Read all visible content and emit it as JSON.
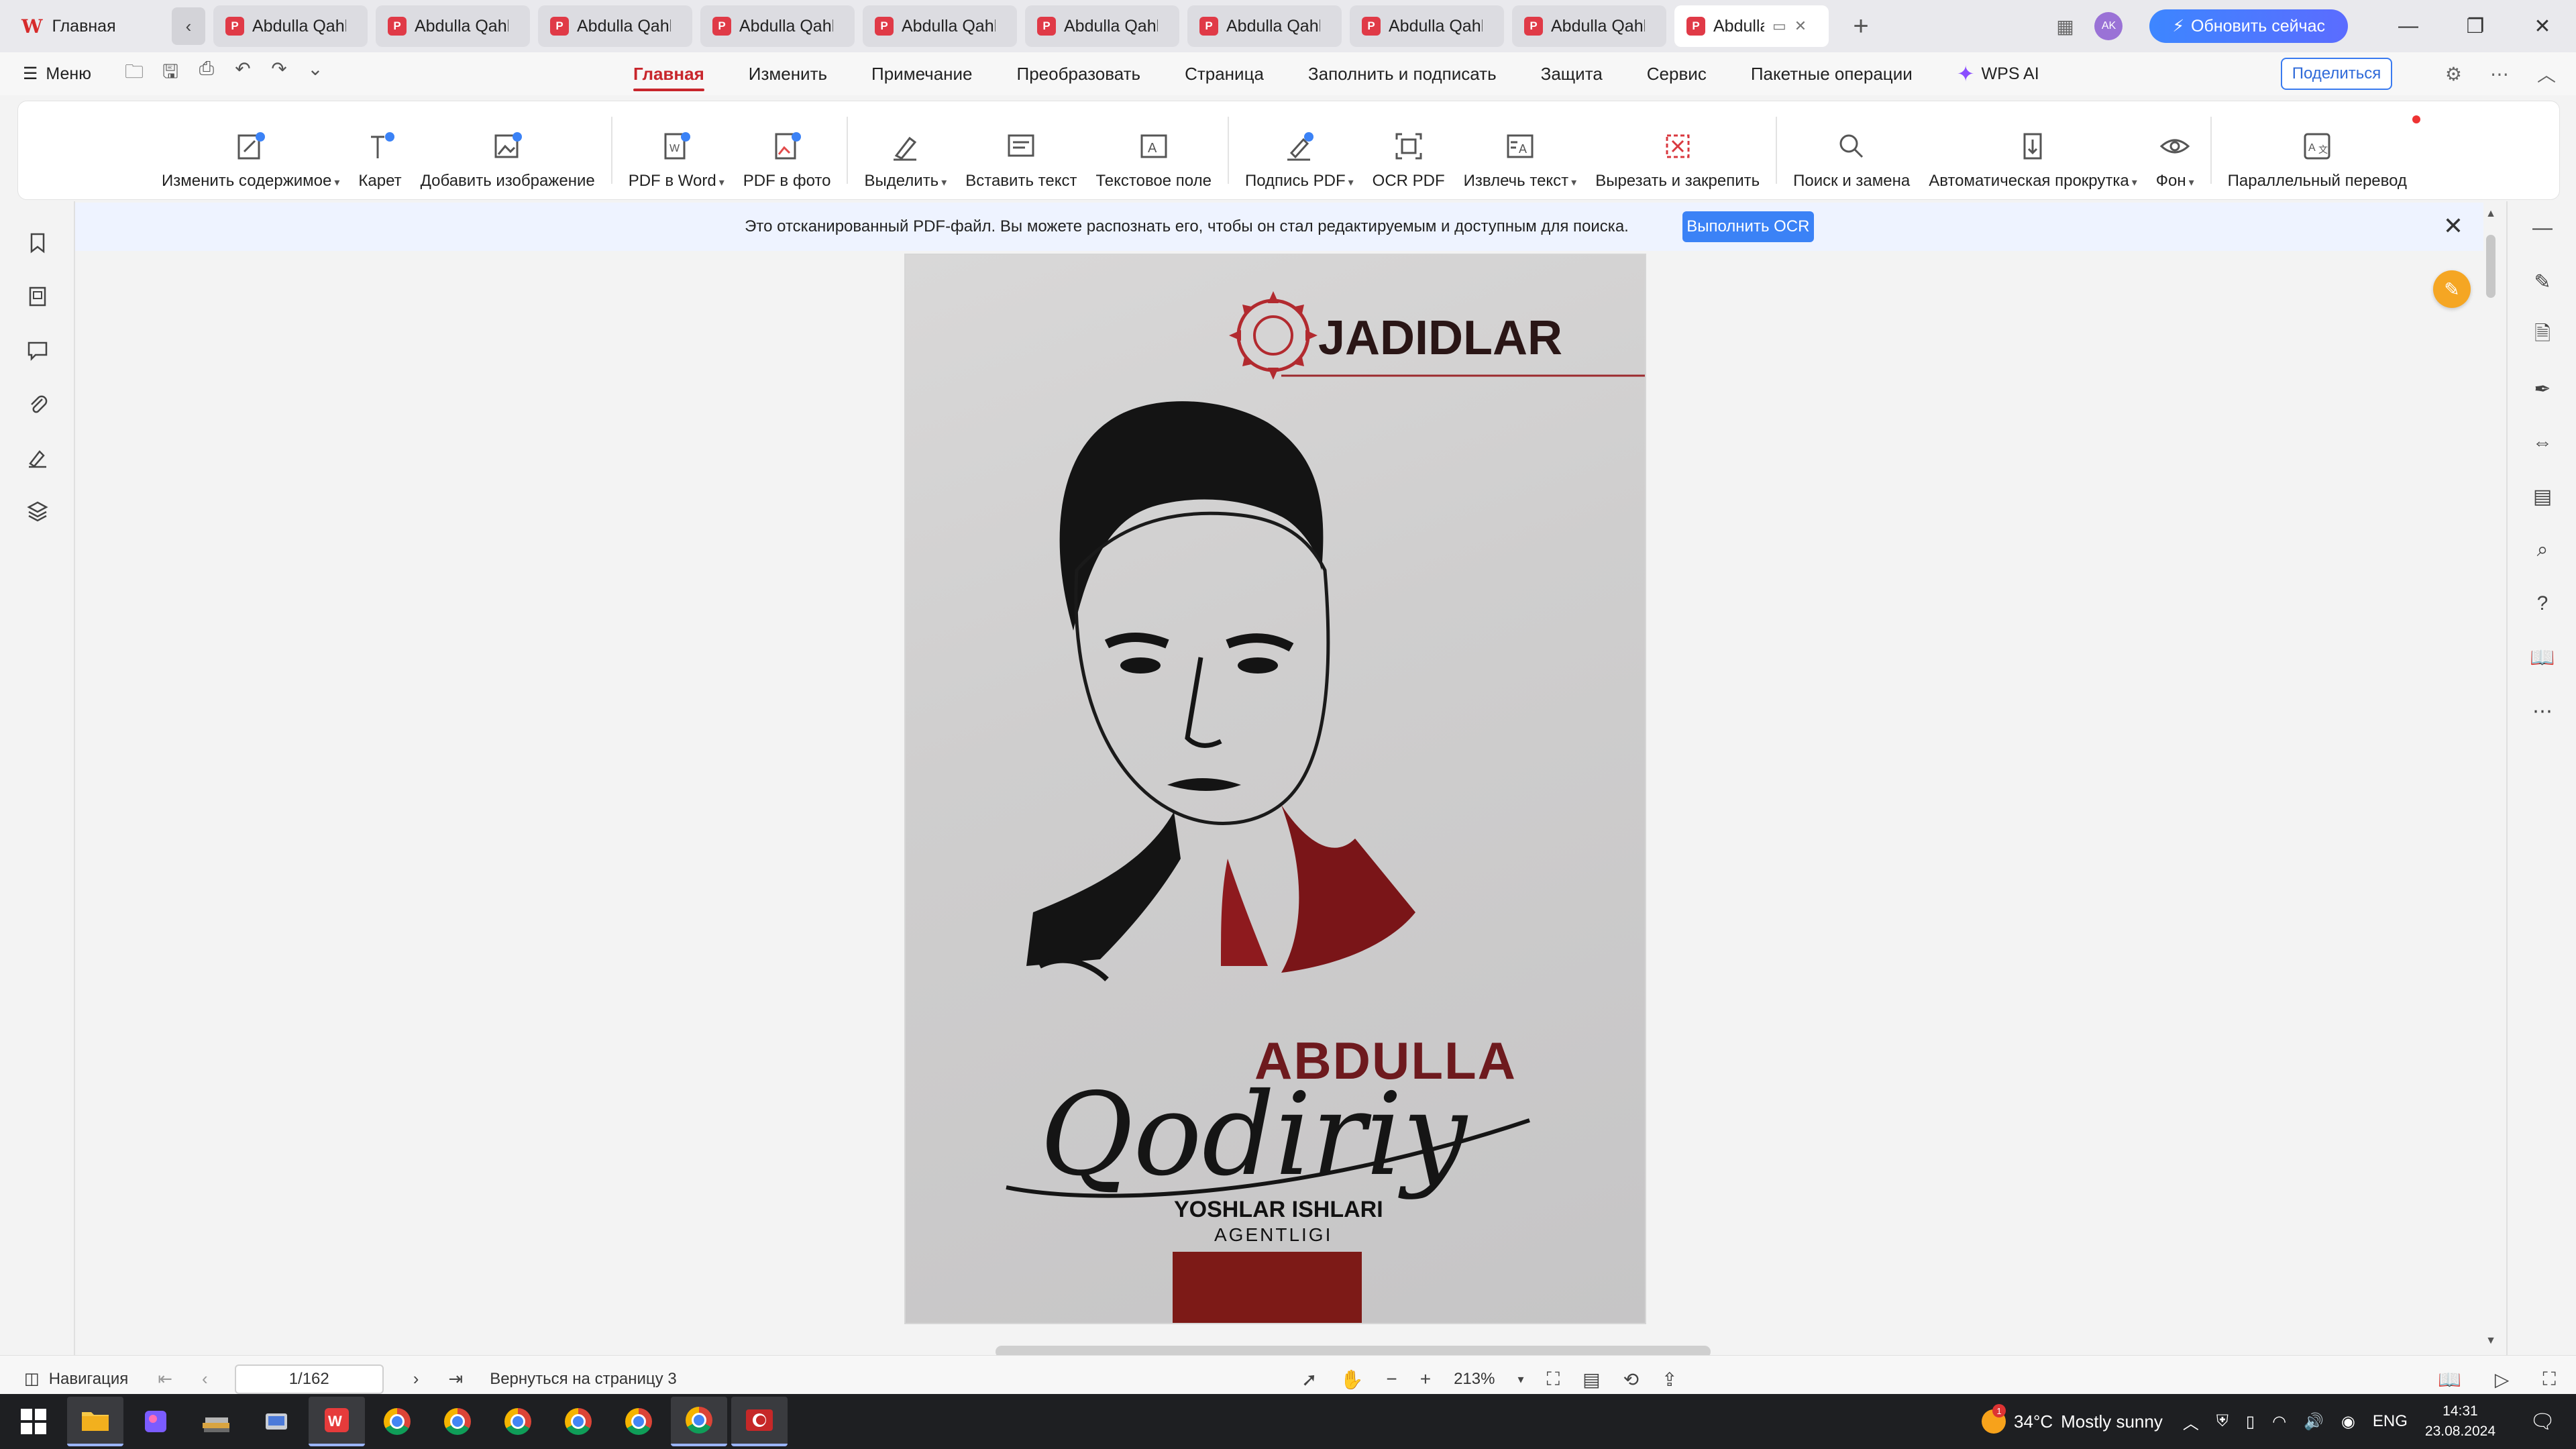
{
  "tabs": {
    "home_label": "Главная",
    "doc_title": "Abdulla Qahhor",
    "doc_tabs": [
      {
        "label": "Abdulla Qahhor"
      },
      {
        "label": "Abdulla Qahhor"
      },
      {
        "label": "Abdulla Qahhor"
      },
      {
        "label": "Abdulla Qahhor"
      },
      {
        "label": "Abdulla Qahhor"
      },
      {
        "label": "Abdulla Qahhor"
      },
      {
        "label": "Abdulla Qahhor"
      },
      {
        "label": "Abdulla Qahhor"
      },
      {
        "label": "Abdulla Qahhor"
      },
      {
        "label": "Abdulla Qahhor"
      }
    ],
    "active_tab_label": "Abdulla Qahhor",
    "avatar_initials": "AK",
    "upgrade_label": "Обновить сейчас"
  },
  "menu": {
    "menu_label": "Меню",
    "tabs": [
      "Главная",
      "Изменить",
      "Примечание",
      "Преобразовать",
      "Страница",
      "Заполнить и подписать",
      "Защита",
      "Сервис",
      "Пакетные операции"
    ],
    "active_tab": "Главная",
    "wps_ai_label": "WPS AI",
    "share_label": "Поделиться"
  },
  "ribbon": {
    "edit_content": "Изменить содержимое",
    "caret": "Карет",
    "add_image": "Добавить изображение",
    "pdf_to_word": "PDF в Word",
    "pdf_to_photo": "PDF в фото",
    "highlight": "Выделить",
    "insert_text": "Вставить текст",
    "text_field": "Текстовое поле",
    "sign_pdf": "Подпись PDF",
    "ocr_pdf": "OCR PDF",
    "extract_text": "Извлечь текст",
    "cut_pin": "Вырезать и закрепить",
    "find_replace": "Поиск и замена",
    "auto_scroll": "Автоматическая прокрутка",
    "background": "Фон",
    "parallel_translate": "Параллельный перевод"
  },
  "ocr_banner": {
    "message": "Это отсканированный PDF-файл. Вы можете распознать его, чтобы он стал редактируемым и доступным для поиска.",
    "button": "Выполнить OCR"
  },
  "document": {
    "brand": "JADIDLAR",
    "author_first": "ABDULLA",
    "author_last": "Qodiriy",
    "publisher_line1": "YOSHLAR ISHLARI",
    "publisher_line2": "AGENTLIGI"
  },
  "statusbar": {
    "nav_label": "Навигация",
    "page_value": "1/162",
    "return_label": "Вернуться на страницу 3",
    "zoom": "213%"
  },
  "taskbar": {
    "temperature": "34°C",
    "weather": "Mostly sunny",
    "weather_badge": "1",
    "lang": "ENG",
    "time": "14:31",
    "date": "23.08.2024"
  },
  "colors": {
    "accent_red": "#c8262c",
    "ocr_blue": "#3b82f6",
    "upgrade_blue": "#3d86ff",
    "taskbar_bg": "#1e1f22"
  }
}
